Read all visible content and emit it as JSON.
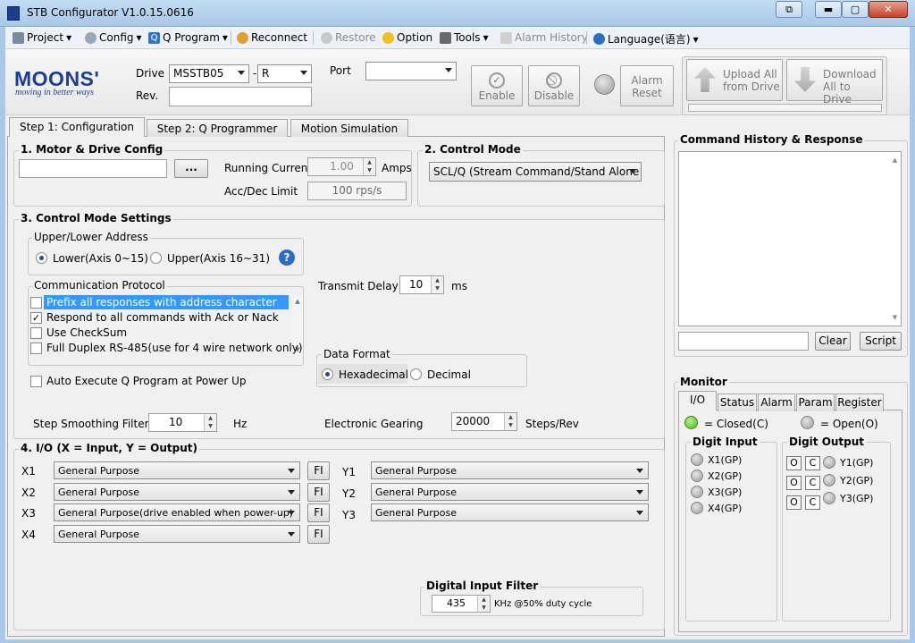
{
  "window": {
    "title": "STB Configurator V1.0.15.0616"
  },
  "menu": {
    "project": "Project",
    "config": "Config",
    "qprogram": "Q Program",
    "reconnect": "Reconnect",
    "restore": "Restore",
    "option": "Option",
    "tools": "Tools",
    "alarm_history": "Alarm History",
    "language": "Language(语言)"
  },
  "toolbar": {
    "drive_label": "Drive",
    "drive_model": "MSSTB05",
    "dash": "-",
    "drive_suffix": "R",
    "rev_label": "Rev.",
    "port_label": "Port",
    "enable": "Enable",
    "disable": "Disable",
    "alarm_reset_1": "Alarm",
    "alarm_reset_2": "Reset",
    "upload_1": "Upload All",
    "upload_2": "from Drive",
    "download_1": "Download",
    "download_2": "All to Drive"
  },
  "logo": {
    "brand": "MOONS'",
    "slogan": "moving in better ways"
  },
  "tabs": {
    "step1": "Step 1: Configuration",
    "step2": "Step 2: Q Programmer",
    "motion": "Motion Simulation"
  },
  "motor": {
    "title": "1. Motor & Drive Config",
    "browse": "...",
    "running_current_label": "Running Current",
    "running_current": "1.00",
    "amps": "Amps",
    "accdec_label": "Acc/Dec Limit",
    "accdec": "100 rps/s"
  },
  "control_mode": {
    "title": "2. Control Mode",
    "value": "SCL/Q (Stream Command/Stand Alone"
  },
  "settings": {
    "title": "3. Control Mode Settings",
    "address_title": "Upper/Lower Address",
    "lower": "Lower(Axis 0~15)",
    "upper": "Upper(Axis 16~31)",
    "help": "?",
    "protocol_title": "Communication Protocol",
    "protocol_items": [
      "Prefix all responses with address character",
      "Respond to all commands with Ack or Nack",
      "Use CheckSum",
      "Full Duplex RS-485(use for 4 wire network only)"
    ],
    "transmit_delay_label": "Transmit Delay",
    "transmit_delay": "10",
    "ms": "ms",
    "data_format_title": "Data Format",
    "hex": "Hexadecimal",
    "dec": "Decimal",
    "auto_exec": "Auto Execute Q Program at Power Up",
    "smoothing_label": "Step Smoothing Filter",
    "smoothing": "10",
    "hz": "Hz",
    "gearing_label": "Electronic Gearing",
    "gearing": "20000",
    "steps_rev": "Steps/Rev"
  },
  "io": {
    "title": "4. I/O (X = Input, Y = Output)",
    "fi": "FI",
    "inputs": [
      {
        "label": "X1",
        "value": "General Purpose"
      },
      {
        "label": "X2",
        "value": "General Purpose"
      },
      {
        "label": "X3",
        "value": "General Purpose(drive enabled when power-up)"
      },
      {
        "label": "X4",
        "value": "General Purpose"
      }
    ],
    "outputs": [
      {
        "label": "Y1",
        "value": "General Purpose"
      },
      {
        "label": "Y2",
        "value": "General Purpose"
      },
      {
        "label": "Y3",
        "value": "General Purpose"
      }
    ],
    "filter_title": "Digital Input Filter",
    "filter_value": "435",
    "filter_unit": "KHz @50% duty cycle"
  },
  "command": {
    "title": "Command History & Response",
    "clear": "Clear",
    "script": "Script"
  },
  "monitor": {
    "title": "Monitor",
    "tabs": [
      "I/O",
      "Status",
      "Alarm",
      "Param",
      "Register"
    ],
    "closed": "= Closed(C)",
    "open": "= Open(O)",
    "digit_input": "Digit Input",
    "digit_output": "Digit Output",
    "inputs": [
      "X1(GP)",
      "X2(GP)",
      "X3(GP)",
      "X4(GP)"
    ],
    "outputs": [
      "Y1(GP)",
      "Y2(GP)",
      "Y3(GP)"
    ],
    "o": "O",
    "c": "C"
  }
}
